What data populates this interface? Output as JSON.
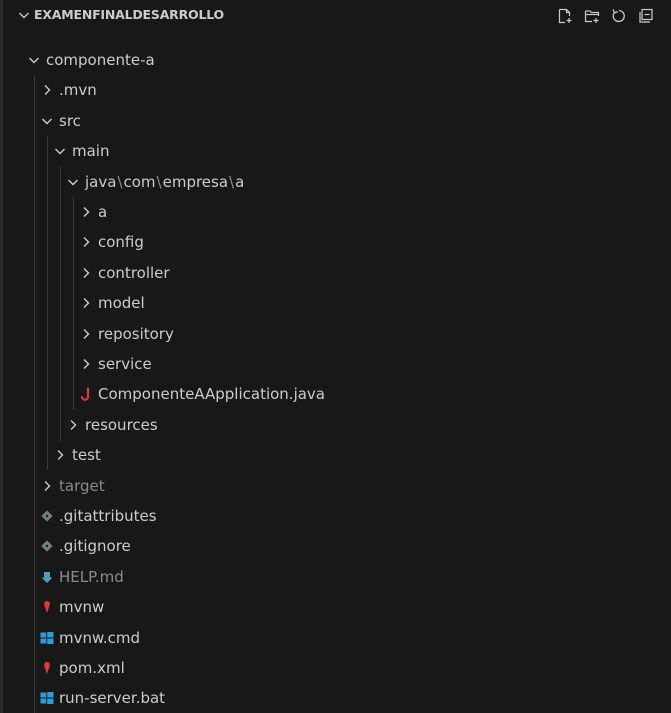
{
  "explorer": {
    "section_title": "EXAMENFINALDESARROLLO",
    "actions": [
      {
        "name": "new-file-icon"
      },
      {
        "name": "new-folder-icon"
      },
      {
        "name": "refresh-icon"
      },
      {
        "name": "collapse-all-icon"
      }
    ],
    "items": [
      {
        "label": "componente-a",
        "depth": 0,
        "kind": "folder",
        "expanded": true
      },
      {
        "label": ".mvn",
        "depth": 1,
        "kind": "folder",
        "expanded": false
      },
      {
        "label": "src",
        "depth": 1,
        "kind": "folder",
        "expanded": true
      },
      {
        "label": "main",
        "depth": 2,
        "kind": "folder",
        "expanded": true
      },
      {
        "label": "java\\com\\empresa\\a",
        "depth": 3,
        "kind": "folder",
        "expanded": true,
        "path": [
          "java",
          "com",
          "empresa",
          "a"
        ]
      },
      {
        "label": "a",
        "depth": 4,
        "kind": "folder",
        "expanded": false
      },
      {
        "label": "config",
        "depth": 4,
        "kind": "folder",
        "expanded": false
      },
      {
        "label": "controller",
        "depth": 4,
        "kind": "folder",
        "expanded": false
      },
      {
        "label": "model",
        "depth": 4,
        "kind": "folder",
        "expanded": false
      },
      {
        "label": "repository",
        "depth": 4,
        "kind": "folder",
        "expanded": false
      },
      {
        "label": "service",
        "depth": 4,
        "kind": "folder",
        "expanded": false
      },
      {
        "label": "ComponenteAApplication.java",
        "depth": 4,
        "kind": "file",
        "icon": "java-icon"
      },
      {
        "label": "resources",
        "depth": 3,
        "kind": "folder",
        "expanded": false
      },
      {
        "label": "test",
        "depth": 2,
        "kind": "folder",
        "expanded": false
      },
      {
        "label": "target",
        "depth": 1,
        "kind": "folder",
        "expanded": false,
        "dim": true
      },
      {
        "label": ".gitattributes",
        "depth": 1,
        "kind": "file",
        "icon": "git-icon"
      },
      {
        "label": ".gitignore",
        "depth": 1,
        "kind": "file",
        "icon": "git-icon"
      },
      {
        "label": "HELP.md",
        "depth": 1,
        "kind": "file",
        "icon": "markdown-icon",
        "dim": true
      },
      {
        "label": "mvnw",
        "depth": 1,
        "kind": "file",
        "icon": "maven-icon"
      },
      {
        "label": "mvnw.cmd",
        "depth": 1,
        "kind": "file",
        "icon": "windows-icon"
      },
      {
        "label": "pom.xml",
        "depth": 1,
        "kind": "file",
        "icon": "maven-icon"
      },
      {
        "label": "run-server.bat",
        "depth": 1,
        "kind": "file",
        "icon": "windows-icon"
      }
    ]
  },
  "colors": {
    "background": "#181818",
    "text": "#cccccc",
    "dim_text": "#8b8b8b",
    "java": "#e2383d",
    "git": "#6d8086",
    "markdown": "#519aba",
    "maven": "#e2383d",
    "windows": "#2f9bd8"
  }
}
